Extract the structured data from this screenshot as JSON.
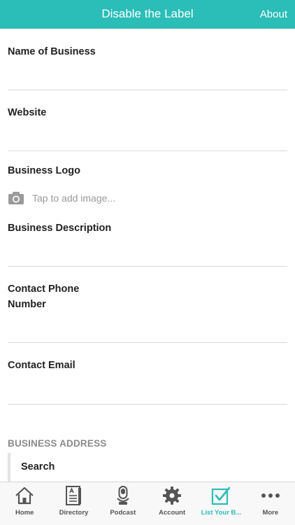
{
  "header": {
    "title": "Disable the Label",
    "about_label": "About"
  },
  "form": {
    "business_name_label": "Name of Business",
    "website_label": "Website",
    "logo_label": "Business Logo",
    "logo_hint": "Tap to add image...",
    "description_label": "Business Description",
    "phone_label_line1": "Contact Phone",
    "phone_label_line2": "Number",
    "email_label": "Contact Email",
    "address_section": "BUSINESS ADDRESS",
    "search_label": "Search"
  },
  "tabbar": {
    "active_color": "#2bbdb7",
    "items": [
      {
        "label": "Home",
        "icon": "home-icon"
      },
      {
        "label": "Directory",
        "icon": "directory-icon"
      },
      {
        "label": "Podcast",
        "icon": "microphone-icon"
      },
      {
        "label": "Account",
        "icon": "gear-icon"
      },
      {
        "label": "List Your B...",
        "icon": "checkbox-icon"
      },
      {
        "label": "More",
        "icon": "more-icon"
      }
    ]
  },
  "colors": {
    "accent": "#2bbdb7",
    "divider": "#d9d9d9",
    "muted_text": "#9a9a9a"
  }
}
